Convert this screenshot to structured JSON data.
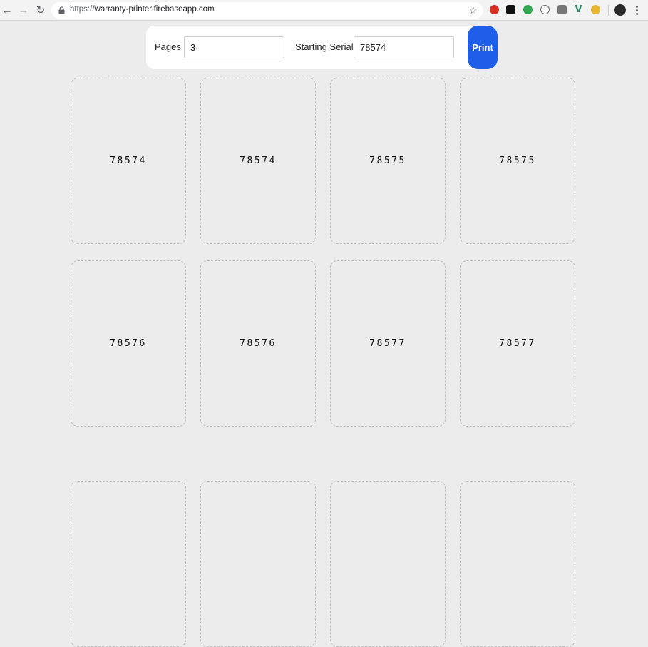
{
  "browser": {
    "url_scheme": "https://",
    "url_host": "warranty-printer.firebaseapp.com"
  },
  "form": {
    "pages_label": "Pages",
    "pages_value": "3",
    "serial_label": "Starting Serial",
    "serial_value": "78574",
    "print_label": "Print"
  },
  "cards": [
    {
      "serial": "78574"
    },
    {
      "serial": "78574"
    },
    {
      "serial": "78575"
    },
    {
      "serial": "78575"
    },
    {
      "serial": "78576"
    },
    {
      "serial": "78576"
    },
    {
      "serial": "78577"
    },
    {
      "serial": "78577"
    },
    {
      "serial": ""
    },
    {
      "serial": ""
    },
    {
      "serial": ""
    },
    {
      "serial": ""
    }
  ],
  "colors": {
    "accent": "#1f5ee8",
    "page_bg": "#ececec",
    "card_border": "#bdbdbd"
  }
}
